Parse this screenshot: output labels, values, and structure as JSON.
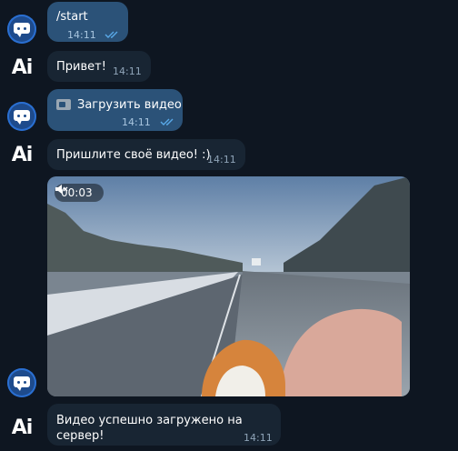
{
  "messages": [
    {
      "sender": "user",
      "text": "/start",
      "time": "14:11",
      "status": "read"
    },
    {
      "sender": "bot",
      "text": "Привет!",
      "time": "14:11"
    },
    {
      "sender": "user",
      "icon": "video-camera-icon",
      "text": "Загрузить видео",
      "time": "14:11",
      "status": "read"
    },
    {
      "sender": "bot",
      "text": "Пришлите своё видео! :)",
      "time": "14:11"
    },
    {
      "sender": "user",
      "type": "video",
      "duration": "00:03",
      "muted": true
    },
    {
      "sender": "bot",
      "text": "Видео успешно загружено на сервер!",
      "time": "14:11"
    }
  ],
  "bot_avatar_text": "Ai",
  "colors": {
    "background": "#0e1621",
    "outgoing_bubble": "#2b5278",
    "incoming_bubble": "#182533",
    "read_ticks": "#59a9e8"
  }
}
